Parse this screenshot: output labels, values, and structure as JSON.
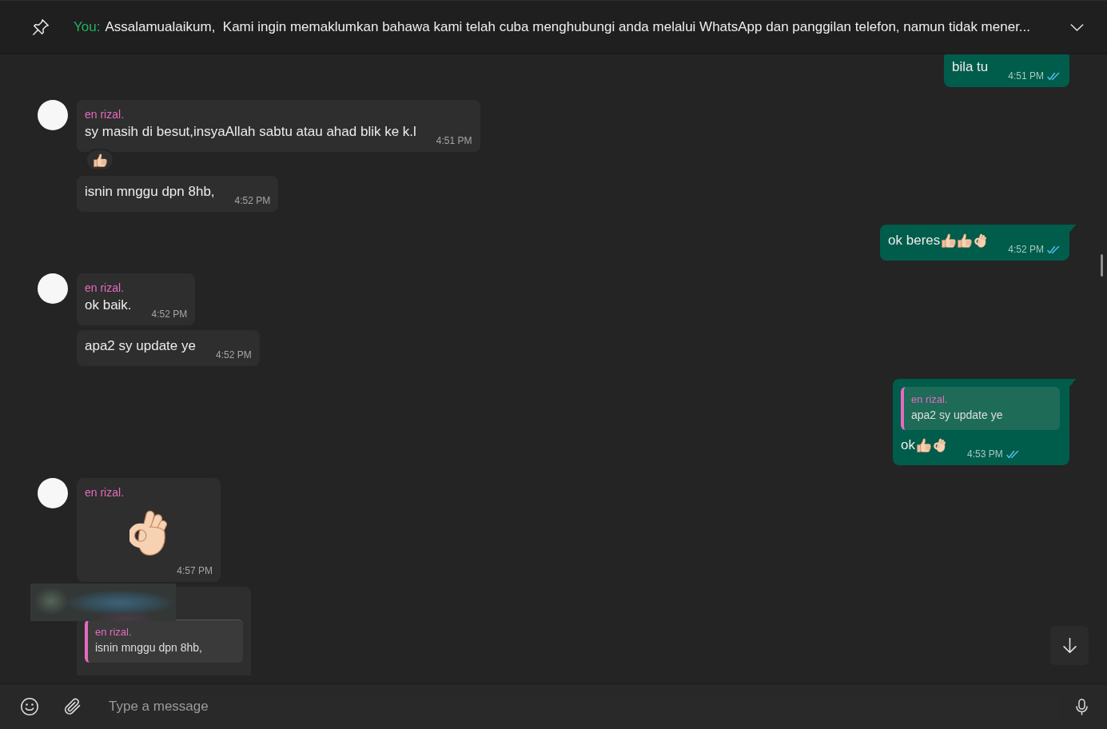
{
  "pinned": {
    "sender": "You:",
    "text": "Assalamualaikum,  Kami ingin memaklumkan bahawa kami telah cuba menghubungi anda melalui WhatsApp dan panggilan telefon, namun tidak mener..."
  },
  "messages": [
    {
      "kind": "outgoing",
      "tail": false,
      "text": "bila tu",
      "time": "4:51 PM",
      "read": true
    },
    {
      "kind": "incoming",
      "sender": "en rizal.",
      "text": "sy masih di besut,insyaAllah sabtu atau ahad blik ke k.l",
      "time": "4:51 PM",
      "reaction": {
        "kind": "thumbs_up"
      }
    },
    {
      "kind": "incoming",
      "text": "isnin mnggu dpn 8hb,",
      "time": "4:52 PM"
    },
    {
      "kind": "outgoing",
      "tail": true,
      "text": "ok beres",
      "emojis": [
        {
          "kind": "thumbs_up"
        },
        {
          "kind": "thumbs_up"
        },
        {
          "kind": "ok_hand"
        }
      ],
      "time": "4:52 PM",
      "read": true
    },
    {
      "kind": "incoming",
      "sender": "en rizal.",
      "text": "ok baik.",
      "time": "4:52 PM"
    },
    {
      "kind": "incoming",
      "text": "apa2 sy update ye",
      "time": "4:52 PM"
    },
    {
      "kind": "outgoing",
      "tail": true,
      "quote": {
        "sender": "en rizal.",
        "text": "apa2 sy update ye"
      },
      "text": "ok",
      "emojis": [
        {
          "kind": "thumbs_up"
        },
        {
          "kind": "ok_hand"
        }
      ],
      "time": "4:53 PM",
      "read": true
    },
    {
      "kind": "incoming",
      "sender": "en rizal.",
      "emojis": [
        {
          "kind": "ok_hand"
        }
      ],
      "time": "4:57 PM"
    },
    {
      "kind": "incoming",
      "redacted": true,
      "quote": {
        "sender": "en rizal.",
        "text": "isnin mnggu dpn 8hb,"
      }
    }
  ],
  "composer": {
    "placeholder": "Type a message"
  }
}
